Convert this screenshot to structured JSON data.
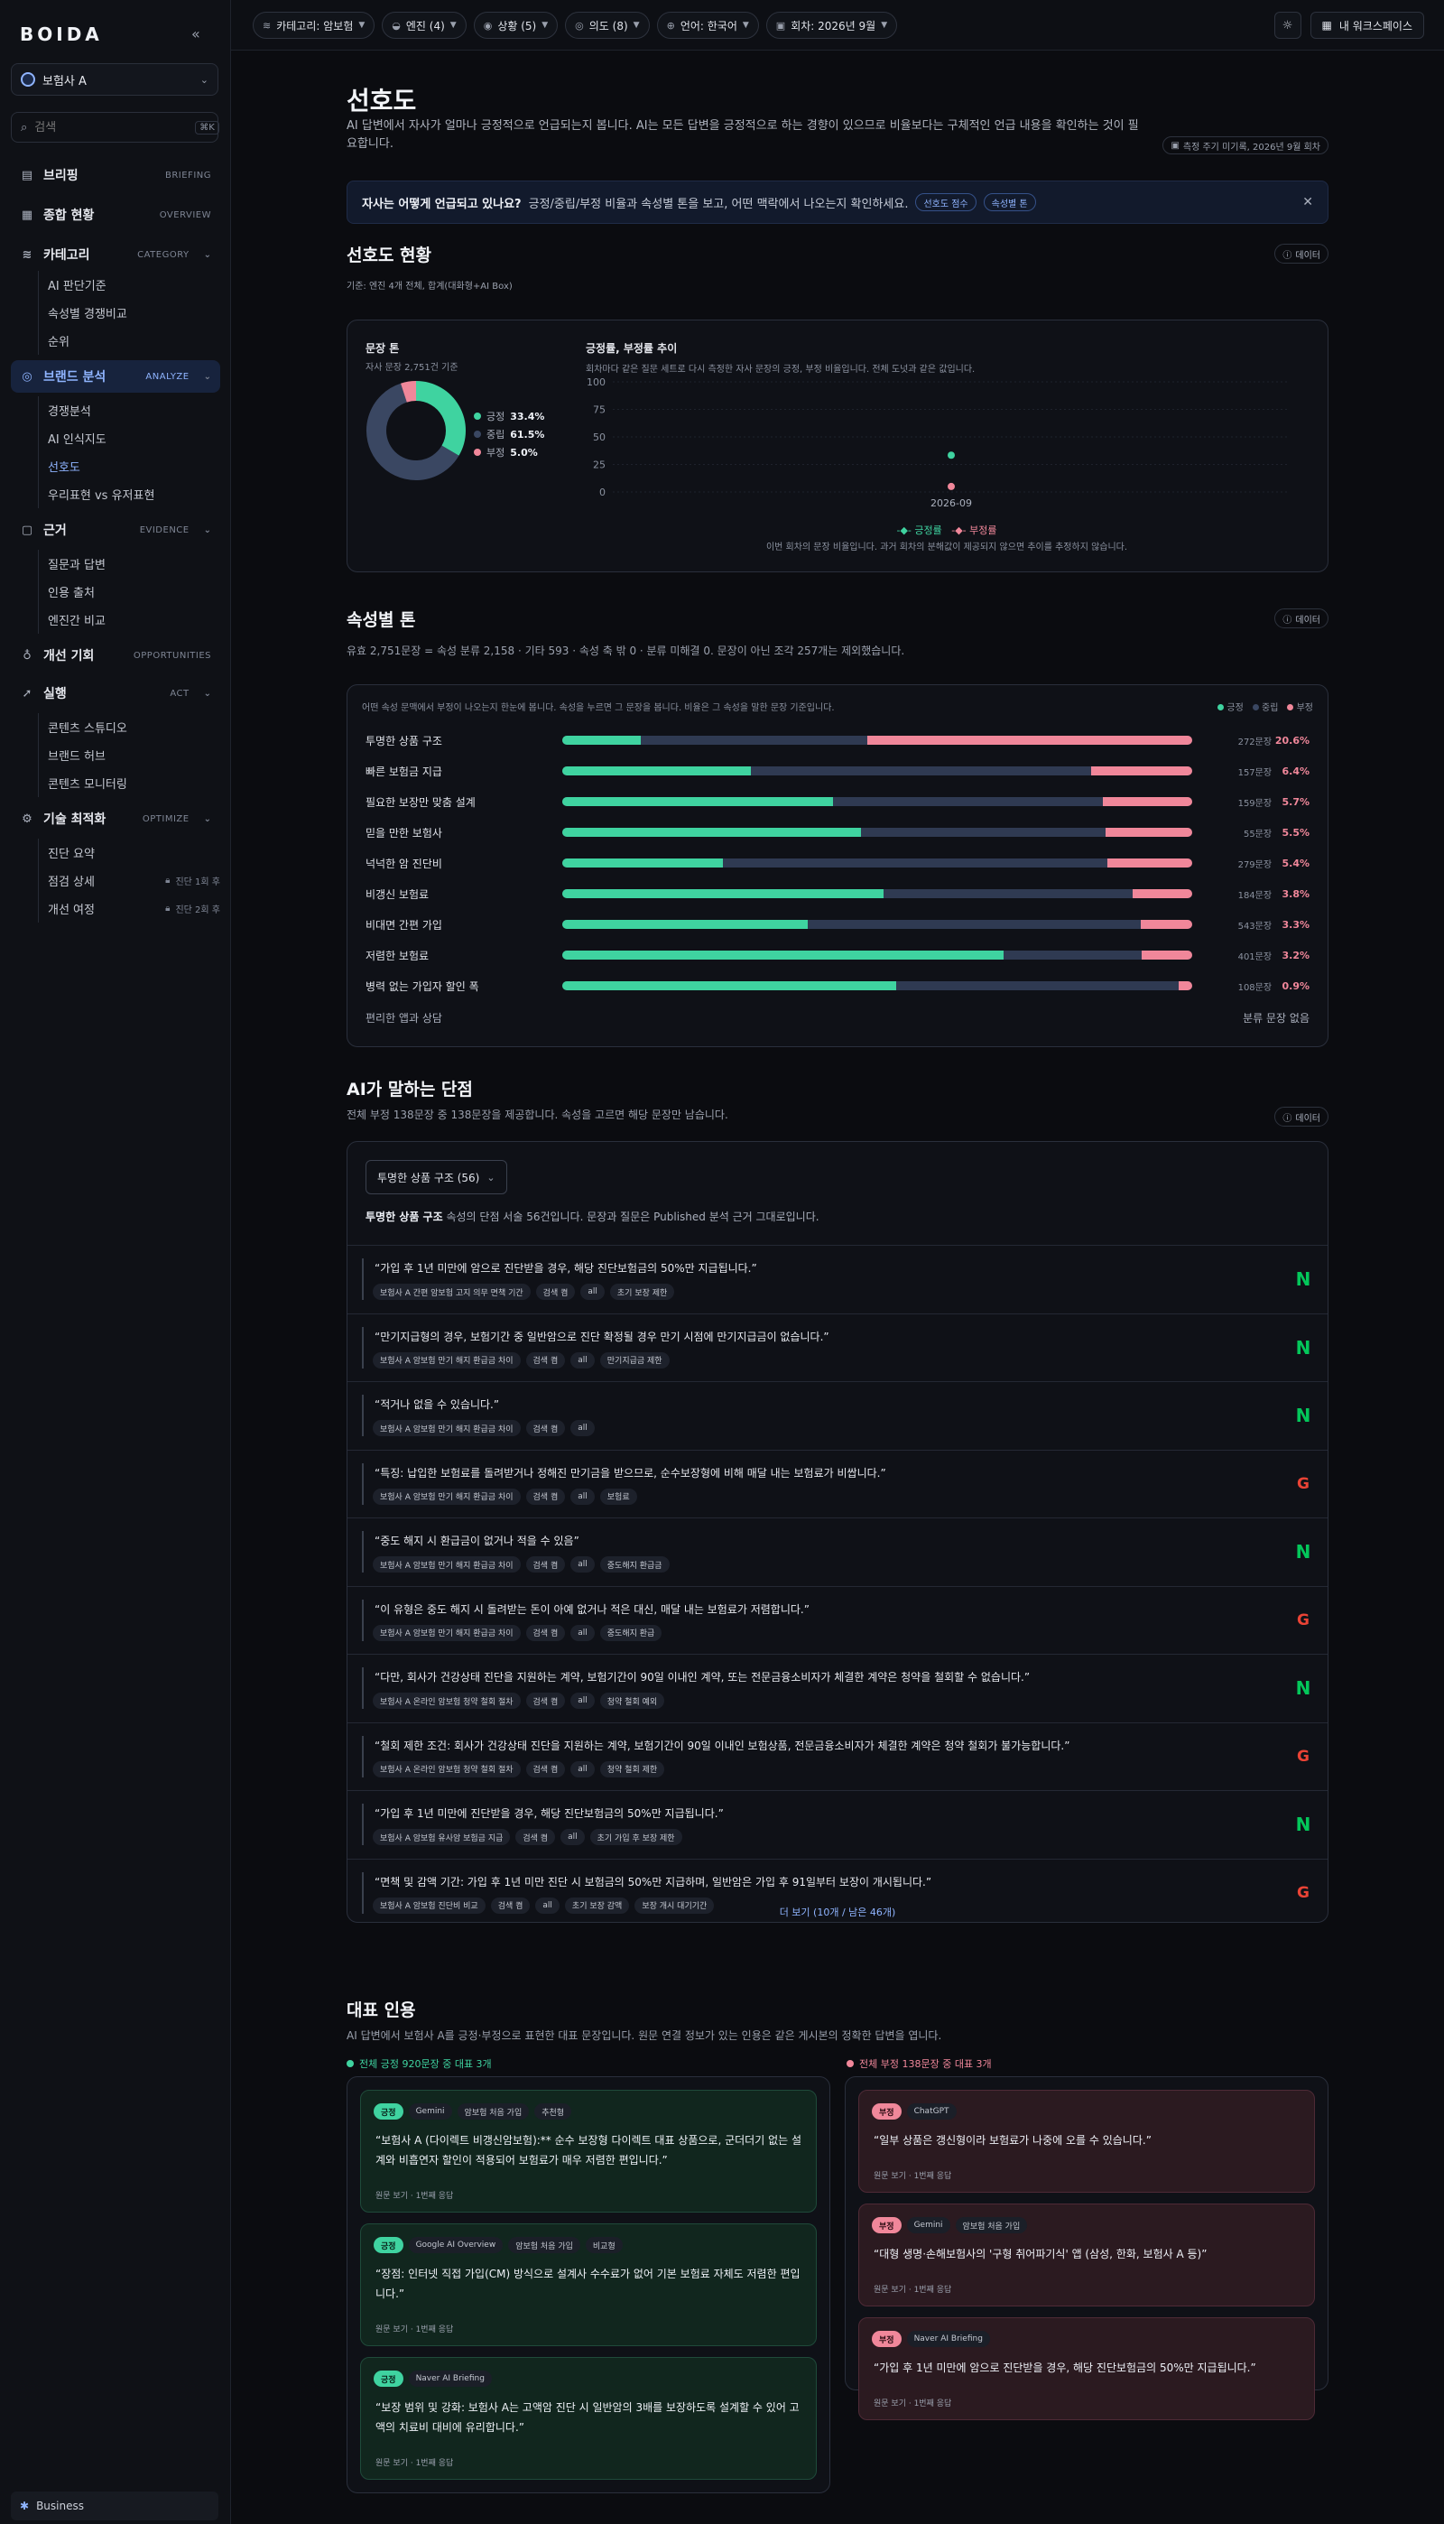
{
  "app": {
    "logo": "BOIDA",
    "brand": "보험사 A",
    "search_placeholder": "검색",
    "search_kbd": "⌘K",
    "plan": "Business"
  },
  "nav": {
    "briefing": {
      "label": "브리핑",
      "tag": "BRIEFING"
    },
    "overview": {
      "label": "종합 현황",
      "tag": "OVERVIEW"
    },
    "category": {
      "label": "카테고리",
      "tag": "CATEGORY",
      "items": [
        "AI 판단기준",
        "속성별 경쟁비교",
        "순위"
      ]
    },
    "analyze": {
      "label": "브랜드 분석",
      "tag": "ANALYZE",
      "items": [
        "경쟁분석",
        "AI 인식지도",
        "선호도",
        "우리표현 vs 유저표현"
      ]
    },
    "evidence": {
      "label": "근거",
      "tag": "EVIDENCE",
      "items": [
        "질문과 답변",
        "인용 출처",
        "엔진간 비교"
      ]
    },
    "opportunities": {
      "label": "개선 기회",
      "tag": "OPPORTUNITIES"
    },
    "act": {
      "label": "실행",
      "tag": "ACT",
      "items": [
        "콘텐츠 스튜디오",
        "브랜드 허브",
        "콘텐츠 모니터링"
      ]
    },
    "optimize": {
      "label": "기술 최적화",
      "tag": "OPTIMIZE",
      "items": [
        "진단 요약",
        "점검 상세",
        "개선 여정"
      ],
      "locks": [
        "",
        "진단 1회 후",
        "진단 2회 후"
      ]
    }
  },
  "filters": [
    "카테고리: 암보험",
    "엔진 (4)",
    "상황 (5)",
    "의도 (8)",
    "언어: 한국어",
    "회차: 2026년 9월"
  ],
  "workspace": "내 워크스페이스",
  "page": {
    "title": "선호도",
    "desc": "AI 답변에서 자사가 얼마나 긍정적으로 언급되는지 봅니다. AI는 모든 답변을 긍정적으로 하는 경향이 있으므로 비율보다는 구체적인 언급 내용을 확인하는 것이 필요합니다.",
    "meta": "측정 주기 미기록, 2026년 9월 회차",
    "banner_q": "자사는 어떻게 언급되고 있나요?",
    "banner_text": "긍정/중립/부정 비율과 속성별 톤을 보고, 어떤 맥락에서 나오는지 확인하세요.",
    "banner_chips": [
      "선호도 점수",
      "속성별 톤"
    ],
    "data_btn": "데이터"
  },
  "status": {
    "title": "선호도 현황",
    "sub": "기준: 엔진 4개 전체, 합계(대화형+AI Box)",
    "tone_title": "문장 톤",
    "tone_sub": "자사 문장 2,751건 기준",
    "tone_legend": [
      {
        "label": "긍정",
        "value": "33.4%",
        "color": "#3fd3a0"
      },
      {
        "label": "중립",
        "value": "61.5%",
        "color": "#3a4762"
      },
      {
        "label": "부정",
        "value": "5.0%",
        "color": "#f0879a"
      }
    ],
    "trend_title": "긍정률, 부정률 추이",
    "trend_sub": "회차마다 같은 질문 세트로 다시 측정한 자사 문장의 긍정, 부정 비율입니다. 전체 도넛과 같은 값입니다.",
    "trend_legend": [
      "긍정률",
      "부정률"
    ],
    "trend_note": "이번 회차의 문장 비율입니다. 과거 회차의 분해값이 제공되지 않으면 추이를 추정하지 않습니다."
  },
  "chart_data": [
    {
      "type": "pie",
      "title": "문장 톤",
      "categories": [
        "긍정",
        "중립",
        "부정"
      ],
      "values": [
        33.4,
        61.5,
        5.0
      ]
    },
    {
      "type": "line",
      "title": "긍정률, 부정률 추이",
      "x": [
        "2026-09"
      ],
      "series": [
        {
          "name": "긍정률",
          "values": [
            33.4
          ]
        },
        {
          "name": "부정률",
          "values": [
            5.0
          ]
        }
      ],
      "ylim": [
        0,
        100
      ],
      "yticks": [
        0,
        25,
        50,
        75,
        100
      ]
    }
  ],
  "attr": {
    "title": "속성별 톤",
    "sub": "유효 2,751문장 = 속성 분류 2,158 · 기타 593 · 속성 축 밖 0 · 분류 미해결 0. 문장이 아닌 조각 257개는 제외했습니다.",
    "head": "어떤 속성 문맥에서 부정이 나오는지 한눈에 봅니다. 속성을 누르면 그 문장을 봅니다. 비율은 그 속성을 말한 문장 기준입니다.",
    "legend": [
      "긍정",
      "중립",
      "부정"
    ],
    "rows": [
      {
        "name": "투명한 상품 구조",
        "pos": 0.125,
        "neg": 0.206,
        "count": "272문장",
        "neg_pct": "20.6%"
      },
      {
        "name": "빠른 보험금 지급",
        "pos": 0.3,
        "neg": 0.064,
        "count": "157문장",
        "neg_pct": "6.4%"
      },
      {
        "name": "필요한 보장만 맞춤 설계",
        "pos": 0.43,
        "neg": 0.057,
        "count": "159문장",
        "neg_pct": "5.7%"
      },
      {
        "name": "믿을 만한 보험사",
        "pos": 0.475,
        "neg": 0.055,
        "count": "55문장",
        "neg_pct": "5.5%"
      },
      {
        "name": "넉넉한 암 진단비",
        "pos": 0.255,
        "neg": 0.054,
        "count": "279문장",
        "neg_pct": "5.4%"
      },
      {
        "name": "비갱신 보험료",
        "pos": 0.51,
        "neg": 0.038,
        "count": "184문장",
        "neg_pct": "3.8%"
      },
      {
        "name": "비대면 간편 가입",
        "pos": 0.39,
        "neg": 0.033,
        "count": "543문장",
        "neg_pct": "3.3%"
      },
      {
        "name": "저렴한 보험료",
        "pos": 0.7,
        "neg": 0.032,
        "count": "401문장",
        "neg_pct": "3.2%"
      },
      {
        "name": "병력 없는 가입자 할인 폭",
        "pos": 0.53,
        "neg": 0.009,
        "count": "108문장",
        "neg_pct": "0.9%"
      }
    ],
    "foot_left": "편리한 앱과 상담",
    "foot_right": "분류 문장 없음"
  },
  "weak": {
    "title": "AI가 말하는 단점",
    "sub": "전체 부정 138문장 중 138문장을 제공합니다. 속성을 고르면 해당 문장만 남습니다.",
    "dropdown": "투명한 상품 구조 (56)",
    "lead_bold": "투명한 상품 구조",
    "lead_text": "속성의 단점 서술 56건입니다. 문장과 질문은 Published 분석 근거 그대로입니다.",
    "quotes": [
      {
        "text": "“가입 후 1년 미만에 암으로 진단받을 경우, 해당 진단보험금의 50%만 지급됩니다.”",
        "tags": [
          "보험사 A 간편 암보험 고지 의무 면책 기간",
          "검색 켬",
          "all",
          "초기 보장 제한"
        ],
        "engine": "naver"
      },
      {
        "text": "“만기지급형의 경우, 보험기간 중 일반암으로 진단 확정될 경우 만기 시점에 만기지급금이 없습니다.”",
        "tags": [
          "보험사 A 암보험 만기 해지 환급금 차이",
          "검색 켬",
          "all",
          "만기지급금 제한"
        ],
        "engine": "naver"
      },
      {
        "text": "“적거나 없을 수 있습니다.”",
        "tags": [
          "보험사 A 암보험 만기 해지 환급금 차이",
          "검색 켬",
          "all"
        ],
        "engine": "naver"
      },
      {
        "text": "“특징: 납입한 보험료를 돌려받거나 정해진 만기금을 받으므로, 순수보장형에 비해 매달 내는 보험료가 비쌉니다.”",
        "tags": [
          "보험사 A 암보험 만기 해지 환급금 차이",
          "검색 켬",
          "all",
          "보험료"
        ],
        "engine": "google"
      },
      {
        "text": "“중도 해지 시 환급금이 없거나 적을 수 있음”",
        "tags": [
          "보험사 A 암보험 만기 해지 환급금 차이",
          "검색 켬",
          "all",
          "중도해지 환급금"
        ],
        "engine": "naver"
      },
      {
        "text": "“이 유형은 중도 해지 시 돌려받는 돈이 아예 없거나 적은 대신, 매달 내는 보험료가 저렴합니다.”",
        "tags": [
          "보험사 A 암보험 만기 해지 환급금 차이",
          "검색 켬",
          "all",
          "중도해지 환급"
        ],
        "engine": "google"
      },
      {
        "text": "“다만, 회사가 건강상태 진단을 지원하는 계약, 보험기간이 90일 이내인 계약, 또는 전문금융소비자가 체결한 계약은 청약을 철회할 수 없습니다.”",
        "tags": [
          "보험사 A 온라인 암보험 청약 철회 절차",
          "검색 켬",
          "all",
          "청약 철회 예외"
        ],
        "engine": "naver"
      },
      {
        "text": "“철회 제한 조건: 회사가 건강상태 진단을 지원하는 계약, 보험기간이 90일 이내인 보험상품, 전문금융소비자가 체결한 계약은 청약 철회가 불가능합니다.”",
        "tags": [
          "보험사 A 온라인 암보험 청약 철회 절차",
          "검색 켬",
          "all",
          "청약 철회 제한"
        ],
        "engine": "google"
      },
      {
        "text": "“가입 후 1년 미만에 진단받을 경우, 해당 진단보험금의 50%만 지급됩니다.”",
        "tags": [
          "보험사 A 암보험 유사암 보험금 지급",
          "검색 켬",
          "all",
          "초기 가입 후 보장 제한"
        ],
        "engine": "naver"
      },
      {
        "text": "“면책 및 감액 기간: 가입 후 1년 미만 진단 시 보험금의 50%만 지급하며, 일반암은 가입 후 91일부터 보장이 개시됩니다.”",
        "tags": [
          "보험사 A 암보험 진단비 비교",
          "검색 켬",
          "all",
          "초기 보장 감액",
          "보장 개시 대기기간"
        ],
        "engine": "google"
      }
    ],
    "more": "더 보기 (10개 / 남은 46개)"
  },
  "rep": {
    "title": "대표 인용",
    "sub": "AI 답변에서 보험사 A를 긍정·부정으로 표현한 대표 문장입니다. 원문 연결 정보가 있는 인용은 같은 게시본의 정확한 답변을 엽니다.",
    "pos_head": "전체 긍정 920문장 중 대표 3개",
    "neg_head": "전체 부정 138문장 중 대표 3개",
    "pos_badge": "긍정",
    "neg_badge": "부정",
    "src": "원문 보기 · 1번째 응답",
    "pos": [
      {
        "tags": [
          "Gemini",
          "암보험 처음 가입",
          "추천형"
        ],
        "text": "“보험사 A (다이렉트 비갱신암보험):** 순수 보장형 다이렉트 대표 상품으로, 군더더기 없는 설계와 비흡연자 할인이 적용되어 보험료가 매우 저렴한 편입니다.”"
      },
      {
        "tags": [
          "Google AI Overview",
          "암보험 처음 가입",
          "비교형"
        ],
        "text": "“장점: 인터넷 직접 가입(CM) 방식으로 설계사 수수료가 없어 기본 보험료 자체도 저렴한 편입니다.”"
      },
      {
        "tags": [
          "Naver AI Briefing"
        ],
        "text": "“보장 범위 및 강화: 보험사 A는 고액암 진단 시 일반암의 3배를 보장하도록 설계할 수 있어 고액의 치료비 대비에 유리합니다.”"
      }
    ],
    "neg": [
      {
        "tags": [
          "ChatGPT"
        ],
        "text": "“일부 상품은 갱신형이라 보험료가 나중에 오를 수 있습니다.”"
      },
      {
        "tags": [
          "Gemini",
          "암보험 처음 가입"
        ],
        "text": "“대형 생명·손해보험사의 '구형 취어파기식' 앱 (삼성, 한화, 보험사 A 등)”"
      },
      {
        "tags": [
          "Naver AI Briefing"
        ],
        "text": "“가입 후 1년 미만에 암으로 진단받을 경우, 해당 진단보험금의 50%만 지급됩니다.”"
      }
    ]
  }
}
